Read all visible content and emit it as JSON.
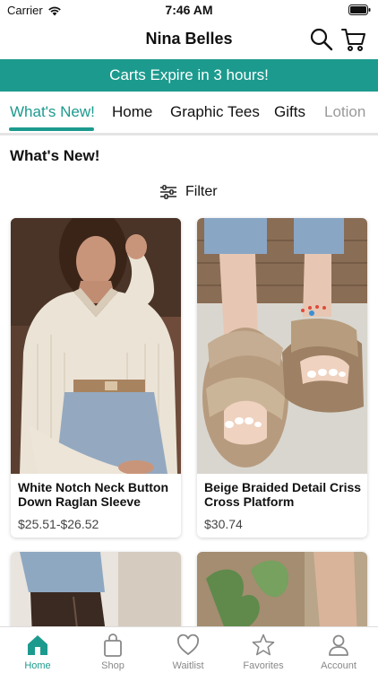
{
  "status_bar": {
    "carrier": "Carrier",
    "time": "7:46 AM"
  },
  "header": {
    "title": "Nina Belles",
    "search_icon": "search-icon",
    "cart_icon": "shopping-cart-icon"
  },
  "banner": {
    "text": "Carts Expire in 3 hours!",
    "color": "#1c9a8e"
  },
  "category_tabs": [
    {
      "label": "What's New!",
      "active": true
    },
    {
      "label": "Home",
      "active": false
    },
    {
      "label": "Graphic Tees",
      "active": false
    },
    {
      "label": "Gifts",
      "active": false
    },
    {
      "label": "Lotion",
      "active": false
    }
  ],
  "section": {
    "title": "What's New!"
  },
  "filter": {
    "label": "Filter",
    "icon": "sliders-icon"
  },
  "products": [
    {
      "name": "White Notch Neck Button Down Raglan Sleeve",
      "price": "$25.51-$26.52"
    },
    {
      "name": "Beige Braided Detail Criss Cross Platform",
      "price": "$30.74"
    }
  ],
  "bottom_nav": [
    {
      "label": "Home",
      "icon": "home-icon",
      "active": true
    },
    {
      "label": "Shop",
      "icon": "bag-icon",
      "active": false
    },
    {
      "label": "Waitlist",
      "icon": "heart-icon",
      "active": false
    },
    {
      "label": "Favorites",
      "icon": "star-icon",
      "active": false
    },
    {
      "label": "Account",
      "icon": "person-icon",
      "active": false
    }
  ],
  "colors": {
    "accent": "#1c9a8e",
    "inactive": "#888888"
  }
}
